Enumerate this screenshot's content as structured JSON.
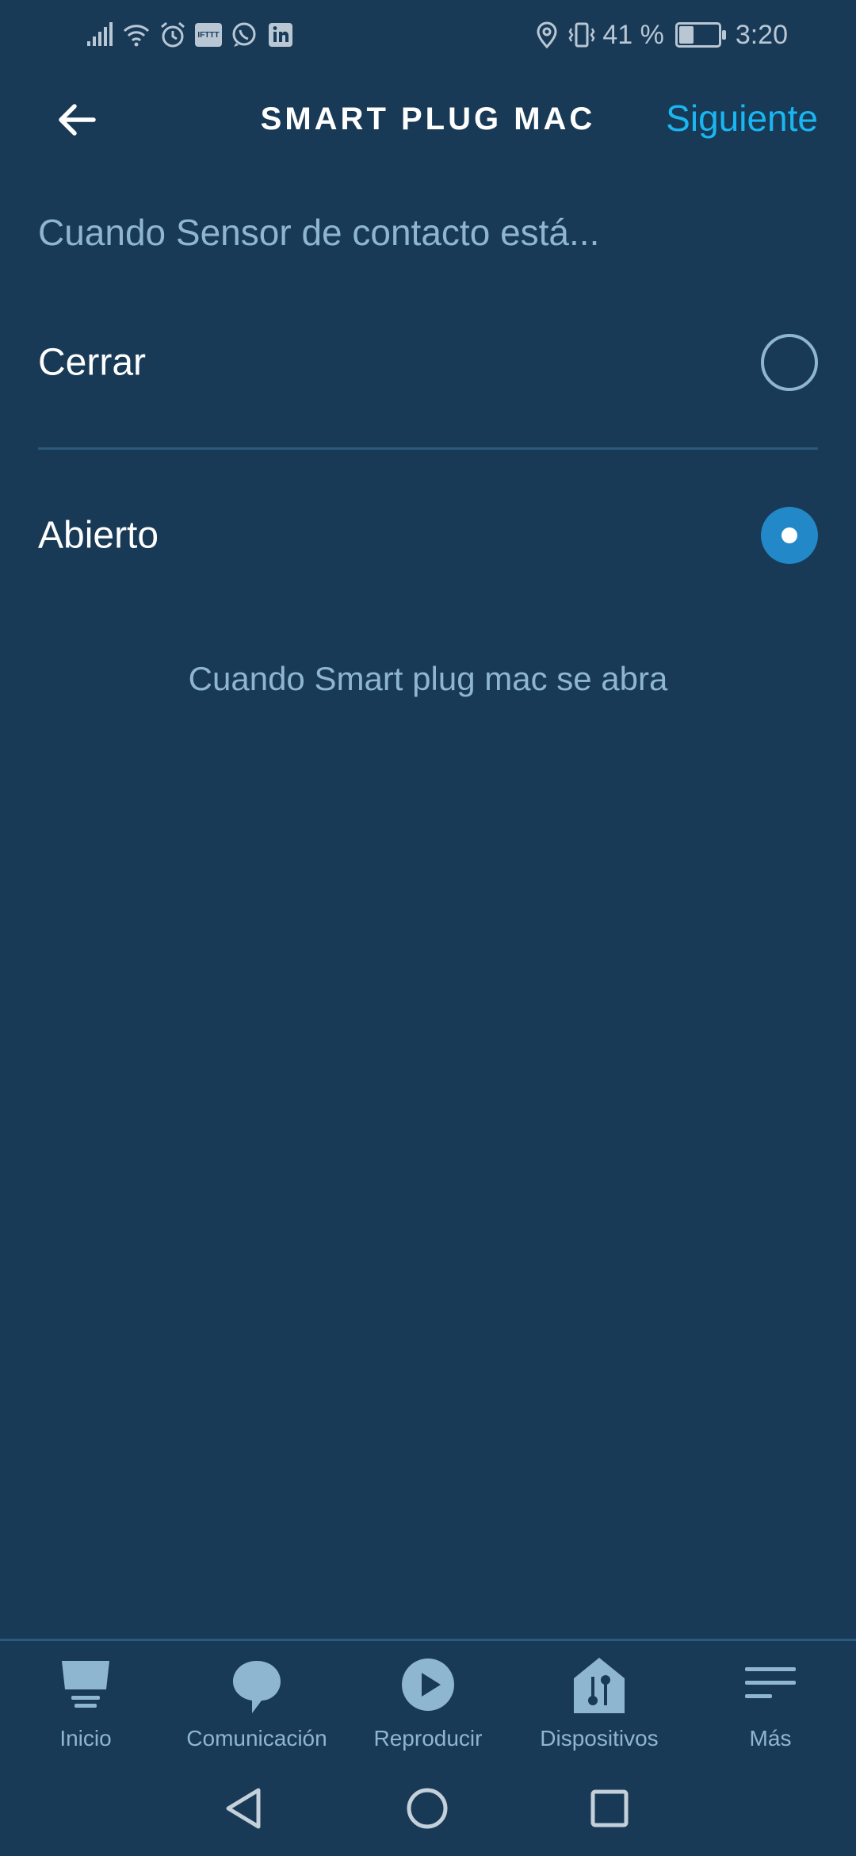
{
  "status_bar": {
    "battery_percent": "41 %",
    "battery_level": 0.41,
    "time": "3:20",
    "left_icons": [
      "signal-icon",
      "wifi-icon",
      "alarm-icon",
      "ifttt-icon",
      "whatsapp-icon",
      "linkedin-icon"
    ],
    "right_icons": [
      "location-icon",
      "vibrate-icon",
      "battery-icon"
    ]
  },
  "header": {
    "back_icon": "back-arrow-icon",
    "title": "SMART PLUG MAC",
    "next_label": "Siguiente"
  },
  "subtitle": "Cuando Sensor de contacto está...",
  "options": [
    {
      "label": "Cerrar",
      "selected": false
    },
    {
      "label": "Abierto",
      "selected": true
    }
  ],
  "hint": "Cuando Smart plug mac se abra",
  "bottom_nav": [
    {
      "label": "Inicio",
      "icon": "home-icon"
    },
    {
      "label": "Comunicación",
      "icon": "chat-bubble-icon"
    },
    {
      "label": "Reproducir",
      "icon": "play-icon"
    },
    {
      "label": "Dispositivos",
      "icon": "devices-icon"
    },
    {
      "label": "Más",
      "icon": "menu-icon"
    }
  ],
  "system_nav": [
    "back-triangle-icon",
    "home-circle-icon",
    "recents-square-icon"
  ],
  "colors": {
    "background": "#183a56",
    "accent": "#1ab6f2",
    "radio_selected": "#2388c7",
    "muted_text": "#8fb6d0"
  }
}
